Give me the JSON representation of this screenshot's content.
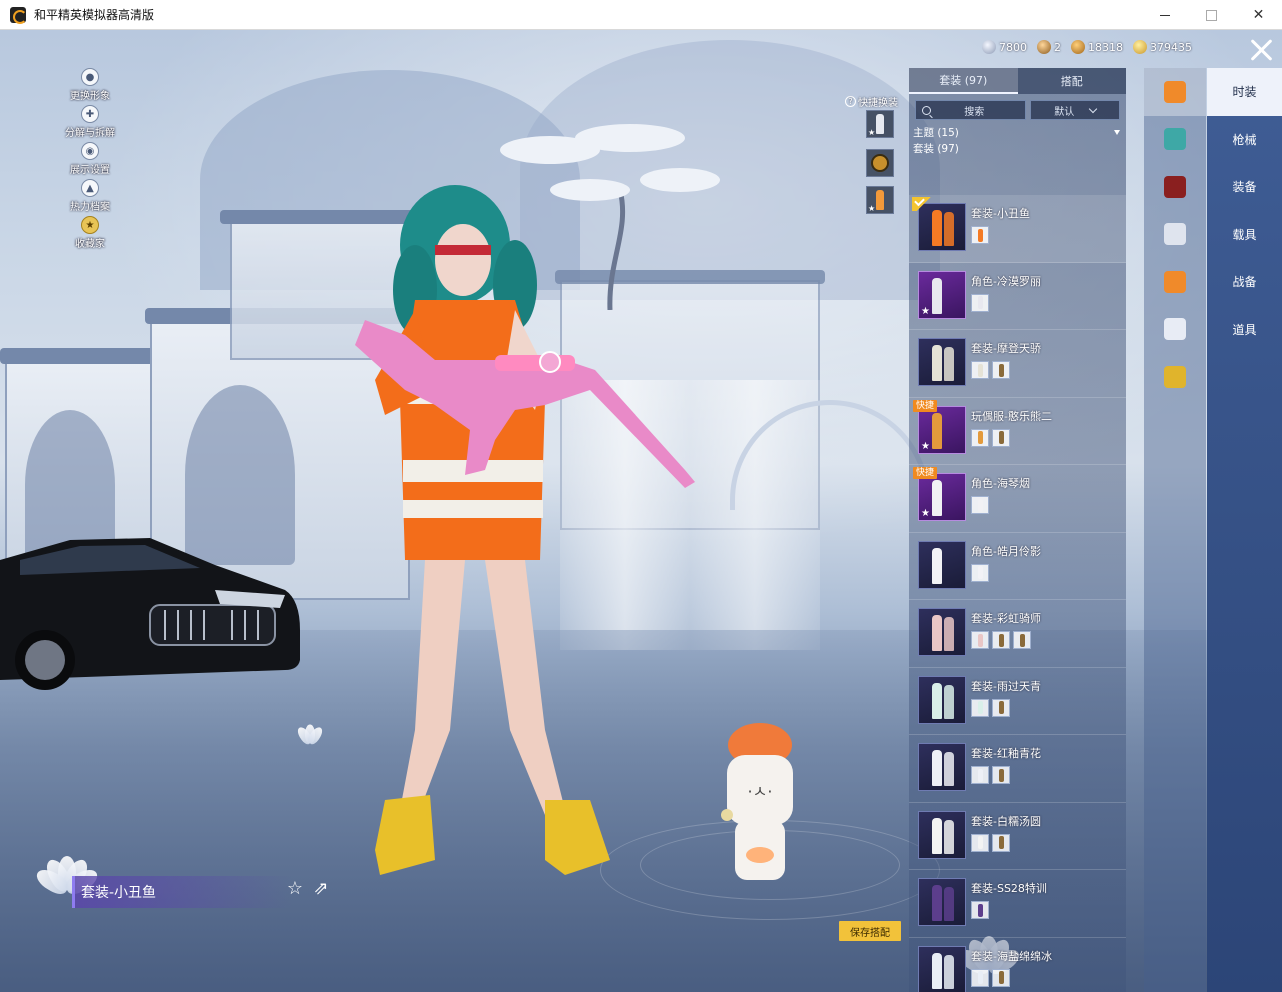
{
  "window": {
    "title": "和平精英模拟器高清版",
    "close_glyph": "✕"
  },
  "currencies": [
    {
      "icon": "silver-coin-icon",
      "value": "7800"
    },
    {
      "icon": "bronze-badge-icon",
      "value": "2"
    },
    {
      "icon": "amber-coin-icon",
      "value": "18318"
    },
    {
      "icon": "gold-coin-icon",
      "value": "379435"
    }
  ],
  "left_menu": [
    {
      "label": "更换形象",
      "icon": "avatar-icon"
    },
    {
      "label": "分解与拆解",
      "icon": "dismantle-icon"
    },
    {
      "label": "展示设置",
      "icon": "eye-icon"
    },
    {
      "label": "热力档案",
      "icon": "flame-icon"
    },
    {
      "label": "收藏家",
      "icon": "collector-badge-icon"
    }
  ],
  "quick_switch": {
    "label": "快捷换装",
    "help": "?"
  },
  "panel": {
    "tabs": [
      "套装 (97)",
      "搭配"
    ],
    "search_placeholder": "搜索",
    "sort_label": "默认",
    "filter_label": "主题 (15)",
    "count_label": "套装 (97)"
  },
  "outfits": [
    {
      "name": "套装-小丑鱼",
      "selected": true,
      "tag": "",
      "parts": 1,
      "color": "#f47a24"
    },
    {
      "name": "角色-冷漠罗丽",
      "selected": false,
      "tag": "",
      "parts": 1,
      "color": "#e8e8ef"
    },
    {
      "name": "套装-摩登天骄",
      "selected": false,
      "tag": "",
      "parts": 2,
      "color": "#e5e2d6"
    },
    {
      "name": "玩偶服-憨乐熊二",
      "selected": false,
      "tag": "快捷",
      "parts": 2,
      "color": "#e39a3c"
    },
    {
      "name": "角色-海琴烟",
      "selected": false,
      "tag": "快捷",
      "parts": 1,
      "color": "#f1f1f4"
    },
    {
      "name": "角色-皓月伶影",
      "selected": false,
      "tag": "",
      "parts": 1,
      "color": "#f2f2f6"
    },
    {
      "name": "套装-彩虹骑师",
      "selected": false,
      "tag": "",
      "parts": 3,
      "color": "#e9c6c6"
    },
    {
      "name": "套装-雨过天青",
      "selected": false,
      "tag": "",
      "parts": 2,
      "color": "#d9efe9"
    },
    {
      "name": "套装-红釉青花",
      "selected": false,
      "tag": "",
      "parts": 2,
      "color": "#eef0f6"
    },
    {
      "name": "套装-白糯汤圆",
      "selected": false,
      "tag": "",
      "parts": 2,
      "color": "#f3f3f3"
    },
    {
      "name": "套装-SS28特训",
      "selected": false,
      "tag": "",
      "parts": 1,
      "color": "#5c3e8c"
    },
    {
      "name": "套装-海盐绵绵冰",
      "selected": false,
      "tag": "",
      "parts": 2,
      "color": "#e9eef6"
    }
  ],
  "categories": [
    {
      "label": "时装",
      "icon": "outfit-icon",
      "color": "#f08a2a"
    },
    {
      "label": "枪械",
      "icon": "gun-icon",
      "color": "#3ea8a6"
    },
    {
      "label": "装备",
      "icon": "backpack-icon",
      "color": "#8a1f1f"
    },
    {
      "label": "载具",
      "icon": "mask-icon",
      "color": "#dfe4ee"
    },
    {
      "label": "战备",
      "icon": "character-icon",
      "color": "#f08a2a"
    },
    {
      "label": "道具",
      "icon": "pants-icon",
      "color": "#e8ecf5"
    },
    {
      "label": "",
      "icon": "shoes-icon",
      "color": "#e0b42c"
    }
  ],
  "current_outfit": "套装-小丑鱼",
  "save_button": "保存搭配",
  "icons": {
    "favorite": "☆",
    "share": "⇗",
    "star": "★"
  }
}
